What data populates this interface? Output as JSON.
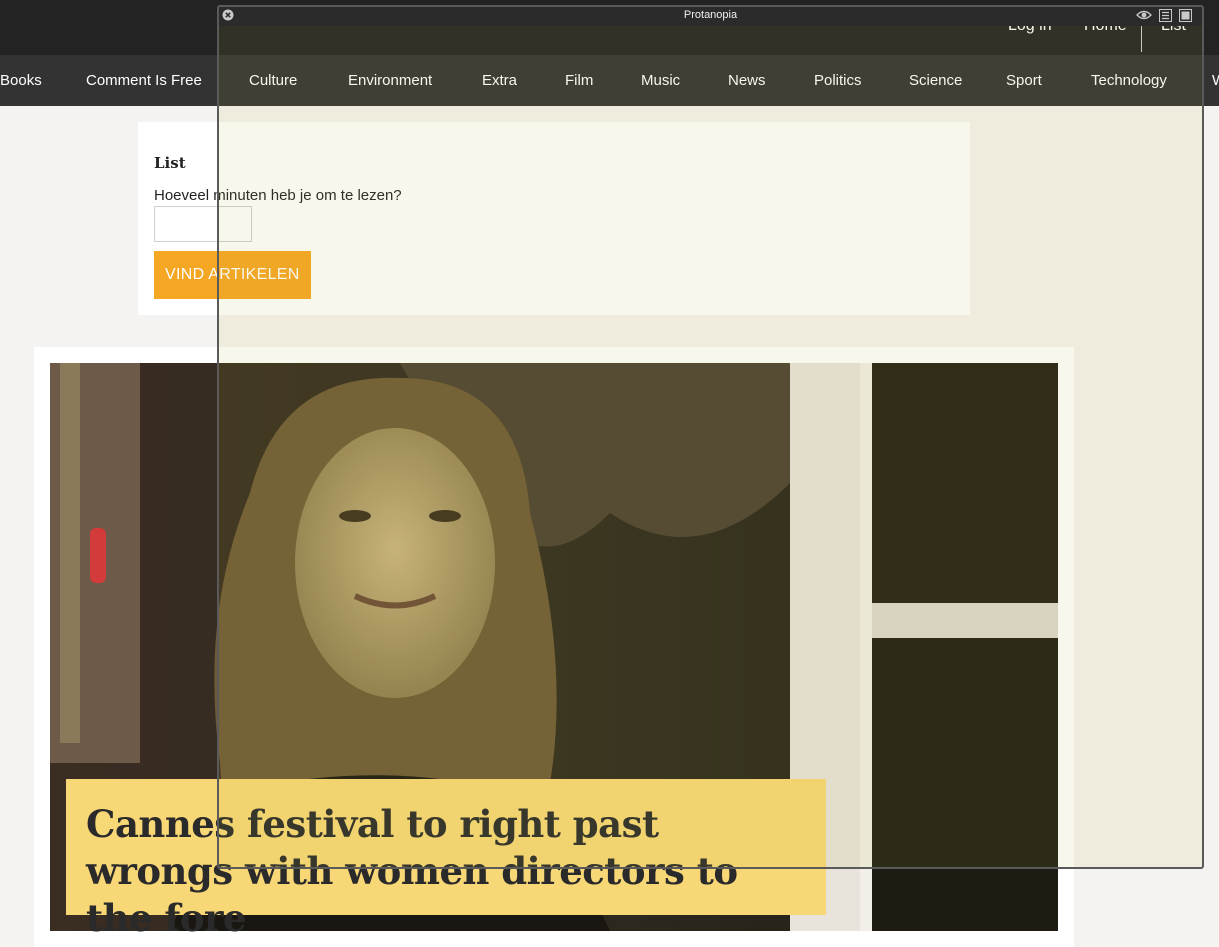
{
  "header": {
    "links": [
      "Log in",
      "Home",
      "List"
    ]
  },
  "nav": {
    "items": [
      "Books",
      "Comment Is Free",
      "Culture",
      "Environment",
      "Extra",
      "Film",
      "Music",
      "News",
      "Politics",
      "Science",
      "Sport",
      "Technology",
      "W"
    ]
  },
  "form": {
    "title": "List",
    "label": "Hoeveel minuten heb je om te lezen?",
    "input_value": "",
    "button_label": "VIND ARTIKELEN"
  },
  "article": {
    "headline": "Cannes festival to right past wrongs with women directors to the fore"
  },
  "overlay": {
    "title": "Protanopia"
  },
  "colors": {
    "topbar": "#232323",
    "navbar": "#333333",
    "button": "#f5a623",
    "headline_bg": "#f8d776"
  }
}
